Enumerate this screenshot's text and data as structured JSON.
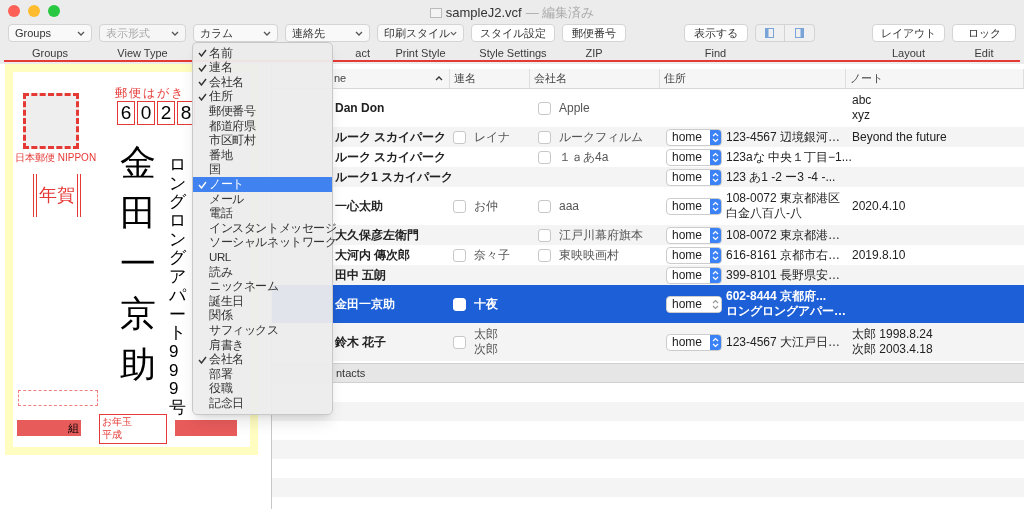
{
  "window": {
    "title": "sampleJ2.vcf",
    "status": "— 編集済み"
  },
  "toolbar": [
    {
      "kind": "popup",
      "label": "Groups",
      "caption": "Groups",
      "disabled": false
    },
    {
      "kind": "popup",
      "label": "表示形式",
      "caption": "View Type",
      "disabled": true
    },
    {
      "kind": "popup",
      "label": "カラム",
      "disabled": false
    },
    {
      "kind": "popup",
      "label": "連絡先",
      "caption": "act",
      "disabled": false
    },
    {
      "kind": "popup",
      "label": "印刷スタイル",
      "caption": "Print Style",
      "disabled": false
    },
    {
      "kind": "button",
      "label": "スタイル設定",
      "caption": "Style Settings"
    },
    {
      "kind": "button",
      "label": "郵便番号",
      "caption": "ZIP"
    },
    {
      "kind": "spacer"
    },
    {
      "kind": "button",
      "label": "表示する",
      "caption": "Find"
    },
    {
      "kind": "segmented"
    },
    {
      "kind": "spacer"
    },
    {
      "kind": "button",
      "label": "レイアウト",
      "caption": "Layout"
    },
    {
      "kind": "button",
      "label": "ロック",
      "caption": "Edit"
    }
  ],
  "column_menu": [
    {
      "label": "名前",
      "checked": true,
      "selected": false
    },
    {
      "label": "連名",
      "checked": true,
      "selected": false
    },
    {
      "label": "会社名",
      "checked": true,
      "selected": false
    },
    {
      "label": "住所",
      "checked": true,
      "selected": false
    },
    {
      "label": "郵便番号",
      "checked": false,
      "selected": false
    },
    {
      "label": "都道府県",
      "checked": false,
      "selected": false
    },
    {
      "label": "市区町村",
      "checked": false,
      "selected": false
    },
    {
      "label": "番地",
      "checked": false,
      "selected": false
    },
    {
      "label": "国",
      "checked": false,
      "selected": false
    },
    {
      "label": "ノート",
      "checked": true,
      "selected": true
    },
    {
      "label": "メール",
      "checked": false,
      "selected": false
    },
    {
      "label": "電話",
      "checked": false,
      "selected": false
    },
    {
      "label": "インスタントメッセージ",
      "checked": false,
      "selected": false
    },
    {
      "label": "ソーシャルネットワーク",
      "checked": false,
      "selected": false
    },
    {
      "label": "URL",
      "checked": false,
      "selected": false
    },
    {
      "label": "読み",
      "checked": false,
      "selected": false
    },
    {
      "label": "ニックネーム",
      "checked": false,
      "selected": false
    },
    {
      "label": "誕生日",
      "checked": false,
      "selected": false
    },
    {
      "label": "関係",
      "checked": false,
      "selected": false
    },
    {
      "label": "サフィックス",
      "checked": false,
      "selected": false
    },
    {
      "label": "肩書き",
      "checked": false,
      "selected": false
    },
    {
      "label": "会社名",
      "checked": true,
      "selected": false
    },
    {
      "label": "部署",
      "checked": false,
      "selected": false
    },
    {
      "label": "役職",
      "checked": false,
      "selected": false
    },
    {
      "label": "記念日",
      "checked": false,
      "selected": false
    }
  ],
  "postcard": {
    "title": "郵便はがき",
    "zip_digits": [
      "6",
      "0",
      "2",
      "8"
    ],
    "stamp_caption": "日本郵便 NIPPON",
    "nenga": "年賀",
    "name": "金田一京助",
    "address": "ロングロングアパート999号",
    "lottery_group": "組",
    "lottery_label": "お年玉",
    "lottery_era": "平成"
  },
  "table": {
    "columns": [
      {
        "label": "ne",
        "sorted": true
      },
      {
        "label": "連名"
      },
      {
        "label": "会社名"
      },
      {
        "label": "住所"
      },
      {
        "label": "ノート"
      }
    ],
    "rows": [
      {
        "name": "Dan Don",
        "selected": false,
        "company": "Apple",
        "company_checked": false,
        "note": [
          "abc",
          "xyz"
        ]
      },
      {
        "name": "ルーク スカイパーク",
        "selected": false,
        "alias": [
          "レイナ"
        ],
        "alias_checked": false,
        "company": "ルークフィルム",
        "company_checked": false,
        "address_label": "home",
        "address": [
          "123-4567 辺境銀河…"
        ],
        "note": [
          "Beyond the future"
        ]
      },
      {
        "name": "ルーク スカイパーク",
        "selected": false,
        "company": "１ａあ4a",
        "company_checked": false,
        "address_label": "home",
        "address": [
          "123aな 中央１丁目−1..."
        ]
      },
      {
        "name": "ルーク1 スカイパーク",
        "selected": false,
        "address_label": "home",
        "address": [
          "123 あ1 -2 ー3 -4 -..."
        ]
      },
      {
        "name": "一心太助",
        "selected": false,
        "alias": [
          "お仲"
        ],
        "alias_checked": false,
        "company": "aaa",
        "company_checked": false,
        "address_label": "home",
        "address": [
          "108-0072 東京都港区",
          "白金八百八-八"
        ],
        "note": [
          "2020.4.10"
        ]
      },
      {
        "name": "大久保彦左衛門",
        "selected": false,
        "company": "江戸川幕府旗本",
        "company_checked": false,
        "address_label": "home",
        "address": [
          "108-0072 東京都港…"
        ]
      },
      {
        "name": "大河内 傳次郎",
        "selected": false,
        "alias": [
          "奈々子"
        ],
        "alias_checked": false,
        "company": "東映映画村",
        "company_checked": false,
        "address_label": "home",
        "address": [
          "616-8161 京都市右…"
        ],
        "note": [
          "2019.8.10"
        ]
      },
      {
        "name": "田中 五朗",
        "selected": false,
        "address_label": "home",
        "address": [
          "399-8101 長野県安…"
        ]
      },
      {
        "name": "金田一京助",
        "selected": true,
        "alias": [
          "十夜"
        ],
        "alias_checked": false,
        "address_label": "home",
        "address": [
          "602-8444 京都府...",
          "ロングロングアパー…"
        ]
      },
      {
        "name": "鈴木 花子",
        "selected": false,
        "alias": [
          "太郎",
          "次郎"
        ],
        "alias_checked": false,
        "address_label": "home",
        "address": [
          "123-4567 大江戸日…"
        ],
        "note": [
          "太郎 1998.8.24",
          "次郎 2003.4.18"
        ]
      }
    ],
    "footer": "ntacts"
  }
}
